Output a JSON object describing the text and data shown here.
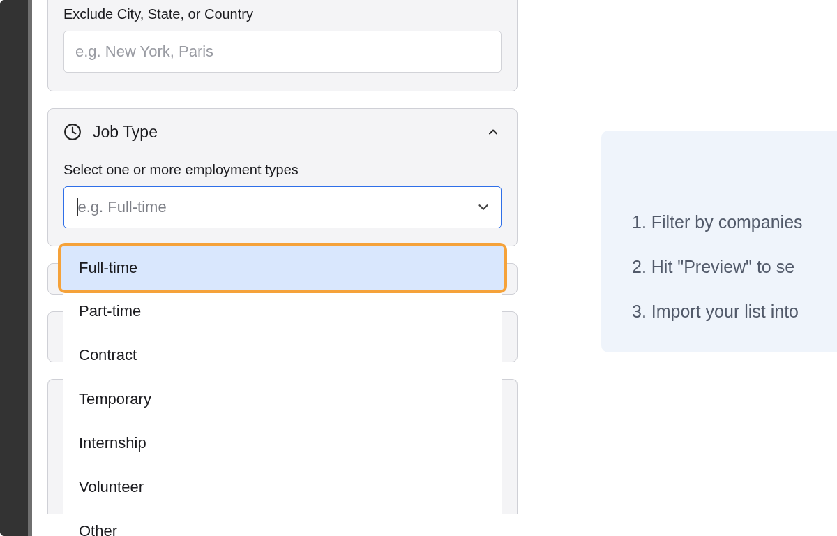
{
  "exclude_location": {
    "label": "Exclude City, State, or Country",
    "placeholder": "e.g. New York, Paris"
  },
  "job_type": {
    "title": "Job Type",
    "expanded": true,
    "label": "Select one or more employment types",
    "placeholder": "e.g. Full-time",
    "options": [
      {
        "label": "Full-time",
        "selected": true
      },
      {
        "label": "Part-time",
        "selected": false
      },
      {
        "label": "Contract",
        "selected": false
      },
      {
        "label": "Temporary",
        "selected": false
      },
      {
        "label": "Internship",
        "selected": false
      },
      {
        "label": "Volunteer",
        "selected": false
      },
      {
        "label": "Other",
        "selected": false
      }
    ]
  },
  "instructions": [
    "1. Filter by companies",
    "2. Hit \"Preview\" to se",
    "3. Import your list into"
  ]
}
